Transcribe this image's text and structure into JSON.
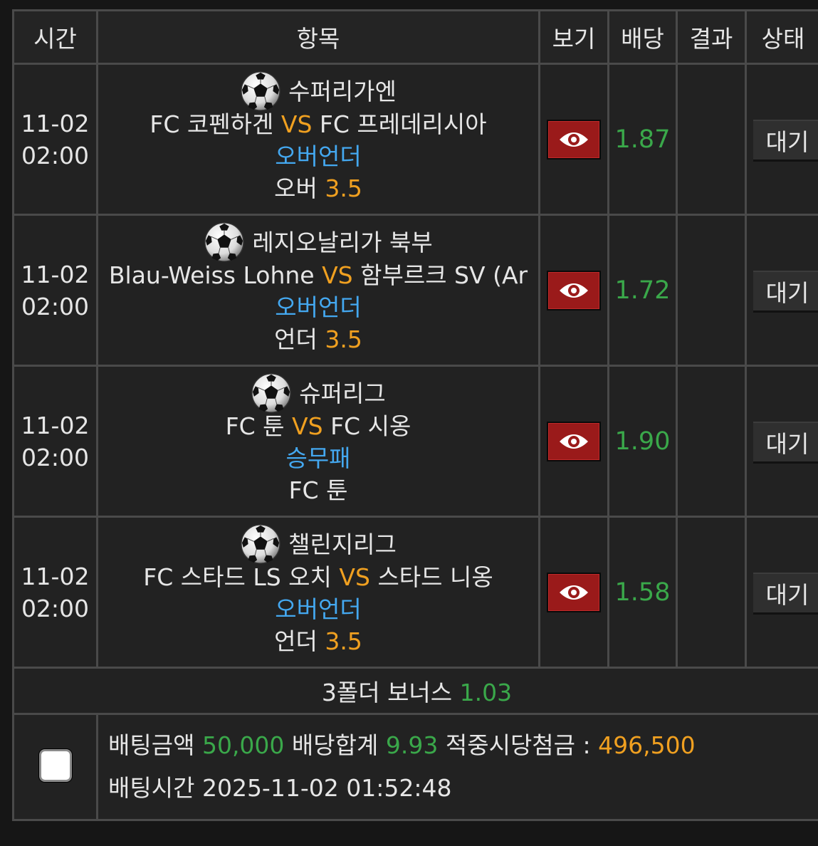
{
  "headers": {
    "time": "시간",
    "item": "항목",
    "view": "보기",
    "odds": "배당",
    "result": "결과",
    "status": "상태"
  },
  "matches": [
    {
      "date": "11-02",
      "time": "02:00",
      "league": "수퍼리가엔",
      "home": "FC 코펜하겐",
      "vs": "VS",
      "away": "FC 프레데리시아",
      "market": "오버언더",
      "pick": "오버",
      "pick_value": "3.5",
      "odds": "1.87",
      "result": "",
      "status": "대기"
    },
    {
      "date": "11-02",
      "time": "02:00",
      "league": "레지오날리가 북부",
      "home": "Blau-Weiss Lohne",
      "vs": "VS",
      "away": "함부르크 SV (Ar",
      "market": "오버언더",
      "pick": "언더",
      "pick_value": "3.5",
      "odds": "1.72",
      "result": "",
      "status": "대기"
    },
    {
      "date": "11-02",
      "time": "02:00",
      "league": "슈퍼리그",
      "home": "FC 툰",
      "vs": "VS",
      "away": "FC 시옹",
      "market": "승무패",
      "pick": "FC 툰",
      "pick_value": "",
      "odds": "1.90",
      "result": "",
      "status": "대기"
    },
    {
      "date": "11-02",
      "time": "02:00",
      "league": "챌린지리그",
      "home": "FC 스타드 LS 오치",
      "vs": "VS",
      "away": "스타드 니옹",
      "market": "오버언더",
      "pick": "언더",
      "pick_value": "3.5",
      "odds": "1.58",
      "result": "",
      "status": "대기"
    }
  ],
  "bonus": {
    "label": "3폴더 보너스",
    "value": "1.03"
  },
  "summary": {
    "bet_amount_label": "배팅금액",
    "bet_amount": "50,000",
    "odds_total_label": "배당합계",
    "odds_total": "9.93",
    "payout_label": "적중시당첨금 :",
    "payout": "496,500",
    "bet_time_label": "배팅시간",
    "bet_time": "2025-11-02 01:52:48"
  },
  "colors": {
    "odds_green": "#3aa84a",
    "vs_orange": "#f0a020",
    "market_blue": "#44a8f0",
    "view_button_red": "#9a1a1a"
  },
  "icons": {
    "league": "soccer-ball-icon",
    "view": "eye-icon",
    "select": "checkbox"
  }
}
